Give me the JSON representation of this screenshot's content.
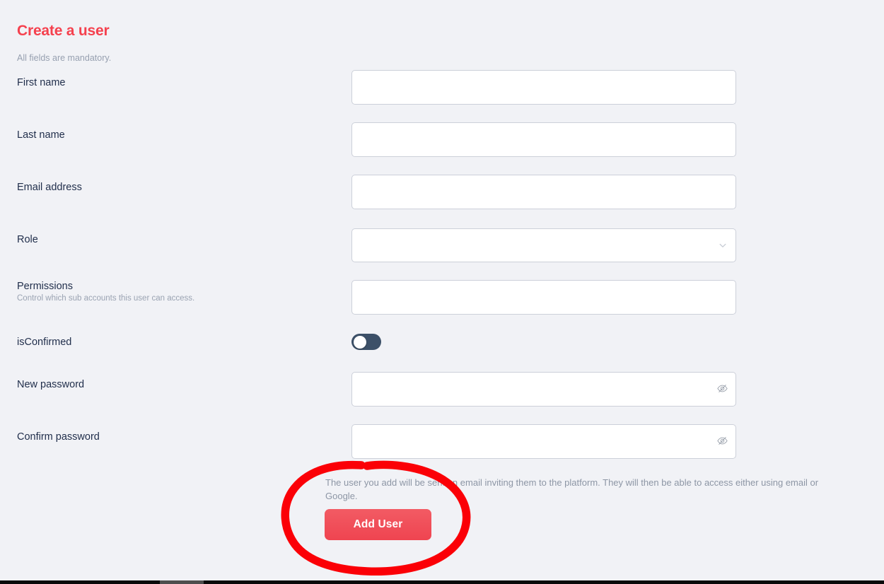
{
  "page": {
    "title": "Create a user",
    "subtitle": "All fields are mandatory.",
    "background_color": "#f1f2f6",
    "title_color": "#f5414e",
    "label_color": "#1f2d4a",
    "help_color": "#9aa3b2"
  },
  "form": {
    "fields": [
      {
        "name": "first-name",
        "label": "First name",
        "help": "",
        "type": "text",
        "value": "",
        "placeholder": ""
      },
      {
        "name": "last-name",
        "label": "Last name",
        "help": "",
        "type": "text",
        "value": "",
        "placeholder": ""
      },
      {
        "name": "email-address",
        "label": "Email address",
        "help": "",
        "type": "text",
        "value": "",
        "placeholder": ""
      },
      {
        "name": "role",
        "label": "Role",
        "help": "",
        "type": "select",
        "value": "",
        "placeholder": "",
        "icon": "chevron-down-icon"
      },
      {
        "name": "permissions",
        "label": "Permissions",
        "help": "Control which sub accounts this user can access.",
        "type": "text",
        "value": "",
        "placeholder": ""
      },
      {
        "name": "is-confirmed",
        "label": "isConfirmed",
        "help": "",
        "type": "toggle",
        "value": "off",
        "track_color": "#3c5068",
        "knob_color": "#ffffff"
      },
      {
        "name": "new-password",
        "label": "New password",
        "help": "",
        "type": "password",
        "value": "",
        "placeholder": "",
        "icon": "eye-slash-icon"
      },
      {
        "name": "confirm-password",
        "label": "Confirm password",
        "help": "",
        "type": "password",
        "value": "",
        "placeholder": "",
        "icon": "eye-slash-icon"
      }
    ],
    "footer_note": "The user you add will be sent an email inviting them to the platform. They will then be able to access either using email or Google.",
    "submit_label": "Add User",
    "submit_color": "#ef4450"
  },
  "annotation": {
    "type": "hand-drawn-ellipse",
    "color": "#fb0007",
    "target": "Add User"
  }
}
